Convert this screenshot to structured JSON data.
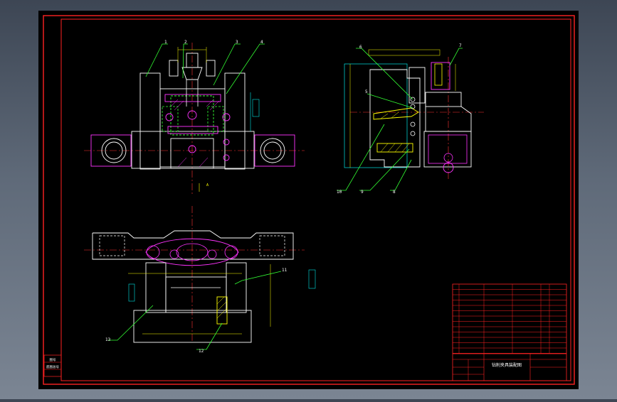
{
  "balloons": [
    "1",
    "2",
    "3",
    "4",
    "5",
    "6",
    "7",
    "8",
    "9",
    "10",
    "11",
    "12",
    "13"
  ],
  "view_markers": {
    "section_a": "A"
  },
  "title_block": {
    "name": "钻削夹具装配图"
  },
  "side_stamp": {
    "label_top": "图号",
    "label_bottom": "底图总号"
  },
  "colors": {
    "background": "#000000",
    "frame": "#ff2222",
    "outline": "#ffffff",
    "dimension": "#ffff00",
    "centerline": "#ff3333",
    "hidden": "#00e5e5",
    "part_magenta": "#ff33ff",
    "part_green": "#33ff33",
    "leader_green": "#33ff33"
  }
}
